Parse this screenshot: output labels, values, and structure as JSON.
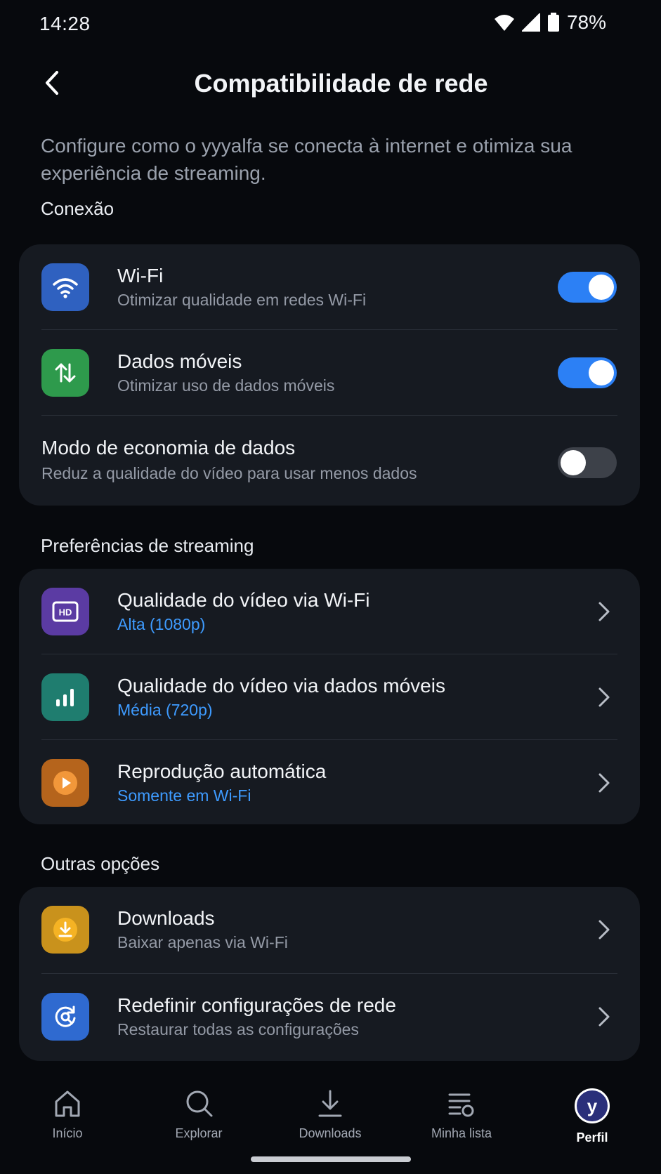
{
  "status_bar": {
    "time": "14:28",
    "battery": "78%"
  },
  "header": {
    "title": "Compatibilidade de rede"
  },
  "intro": "Configure como o yyyalfa se conecta à internet e otimiza sua experiência de streaming.",
  "sections": {
    "connection": {
      "label": "Conexão",
      "items": [
        {
          "title": "Wi-Fi",
          "subtitle": "Otimizar qualidade em redes Wi-Fi",
          "toggle": true,
          "icon": "wifi-icon",
          "color": "#2f61c0"
        },
        {
          "title": "Dados móveis",
          "subtitle": "Otimizar uso de dados móveis",
          "toggle": true,
          "icon": "arrows-up-down-icon",
          "color": "#2e9a4c"
        },
        {
          "title": "Modo de economia de dados",
          "subtitle": "Reduz a qualidade do vídeo para usar menos dados",
          "toggle": false
        }
      ]
    },
    "streaming": {
      "label": "Preferências de streaming",
      "items": [
        {
          "title": "Qualidade do vídeo via Wi-Fi",
          "value": "Alta (1080p)",
          "icon": "hd-icon",
          "color": "#5b3ba3"
        },
        {
          "title": "Qualidade do vídeo via dados móveis",
          "value": "Média (720p)",
          "icon": "signal-bars-icon",
          "color": "#1f7d6f"
        },
        {
          "title": "Reprodução automática",
          "value": "Somente em Wi-Fi",
          "icon": "play-icon",
          "color": "#b5641c"
        }
      ]
    },
    "other": {
      "label": "Outras opções",
      "items": [
        {
          "title": "Downloads",
          "subtitle": "Baixar apenas via Wi-Fi",
          "icon": "download-icon",
          "color": "#c9921c"
        },
        {
          "title": "Redefinir configurações de rede",
          "subtitle": "Restaurar todas as configurações",
          "icon": "reset-network-icon",
          "color": "#2f6ad0"
        }
      ]
    }
  },
  "bottom_nav": {
    "items": [
      {
        "label": "Início",
        "icon": "home-icon"
      },
      {
        "label": "Explorar",
        "icon": "search-icon"
      },
      {
        "label": "Downloads",
        "icon": "download-icon"
      },
      {
        "label": "Minha lista",
        "icon": "list-icon"
      },
      {
        "label": "Perfil",
        "icon": "avatar",
        "initial": "y",
        "active": true
      }
    ]
  }
}
